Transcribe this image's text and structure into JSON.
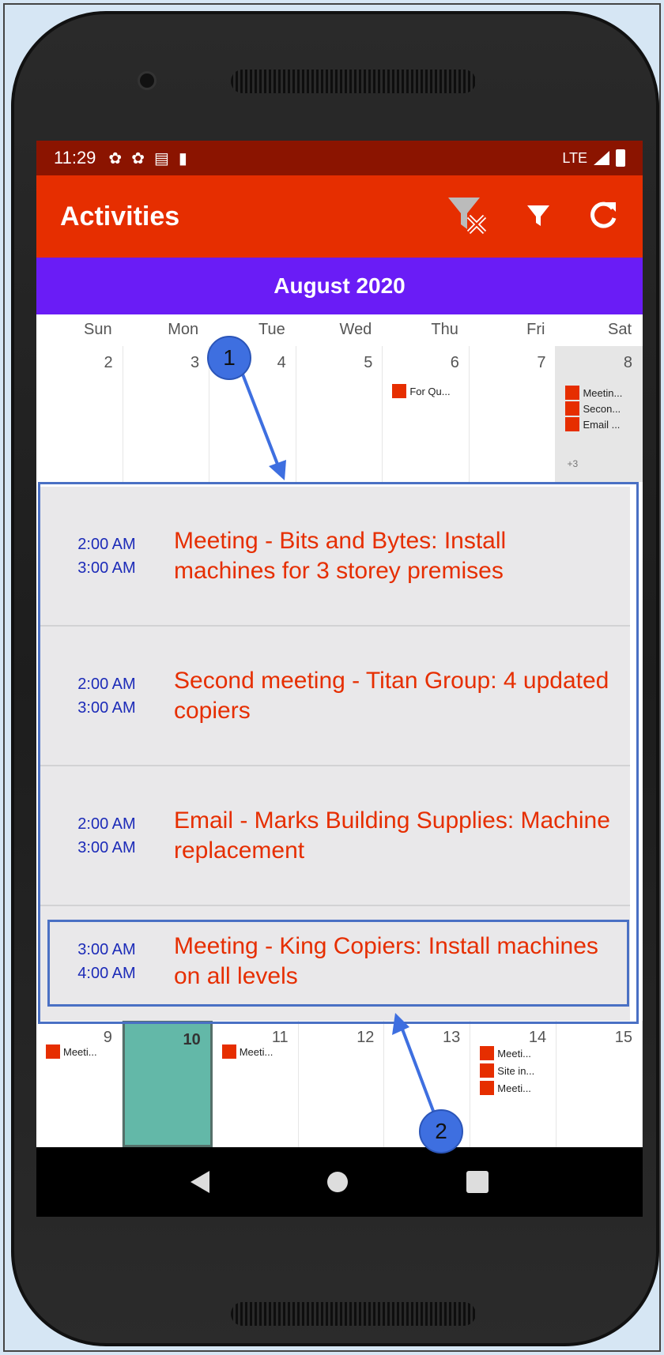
{
  "status_bar": {
    "time": "11:29",
    "network": "LTE"
  },
  "app_bar": {
    "title": "Activities",
    "actions": [
      "clear-filter-icon",
      "filter-icon",
      "refresh-icon"
    ]
  },
  "calendar": {
    "month_title": "August 2020",
    "weekdays": [
      "Sun",
      "Mon",
      "Tue",
      "Wed",
      "Thu",
      "Fri",
      "Sat"
    ],
    "week1": {
      "days": [
        "2",
        "3",
        "4",
        "5",
        "6",
        "7",
        "8"
      ],
      "thu_event": "For Qu...",
      "sat_events": [
        "Meetin...",
        "Secon...",
        "Email ..."
      ],
      "sat_more": "+3"
    },
    "week2": {
      "days": [
        "9",
        "10",
        "11",
        "12",
        "13",
        "14",
        "15"
      ],
      "sun_event": "Meeti...",
      "tue_event": "Meeti...",
      "fri_events": [
        "Meeti...",
        "Site in...",
        "Meeti..."
      ]
    }
  },
  "activities": [
    {
      "start": "2:00 AM",
      "end": "3:00 AM",
      "text": "Meeting  -  Bits and Bytes: Install machines for 3 storey premises"
    },
    {
      "start": "2:00 AM",
      "end": "3:00 AM",
      "text": "Second meeting  -  Titan Group: 4 updated copiers"
    },
    {
      "start": "2:00 AM",
      "end": "3:00 AM",
      "text": "Email  -  Marks Building Supplies: Machine replacement"
    },
    {
      "start": "3:00 AM",
      "end": "4:00 AM",
      "text": "Meeting  -  King Copiers: Install machines on all levels"
    }
  ],
  "callouts": {
    "one": "1",
    "two": "2"
  },
  "colors": {
    "accent": "#e62e00",
    "status": "#8b1400",
    "month": "#6a1cf6",
    "today": "#63b8a8",
    "callout": "#3e6fe0"
  }
}
